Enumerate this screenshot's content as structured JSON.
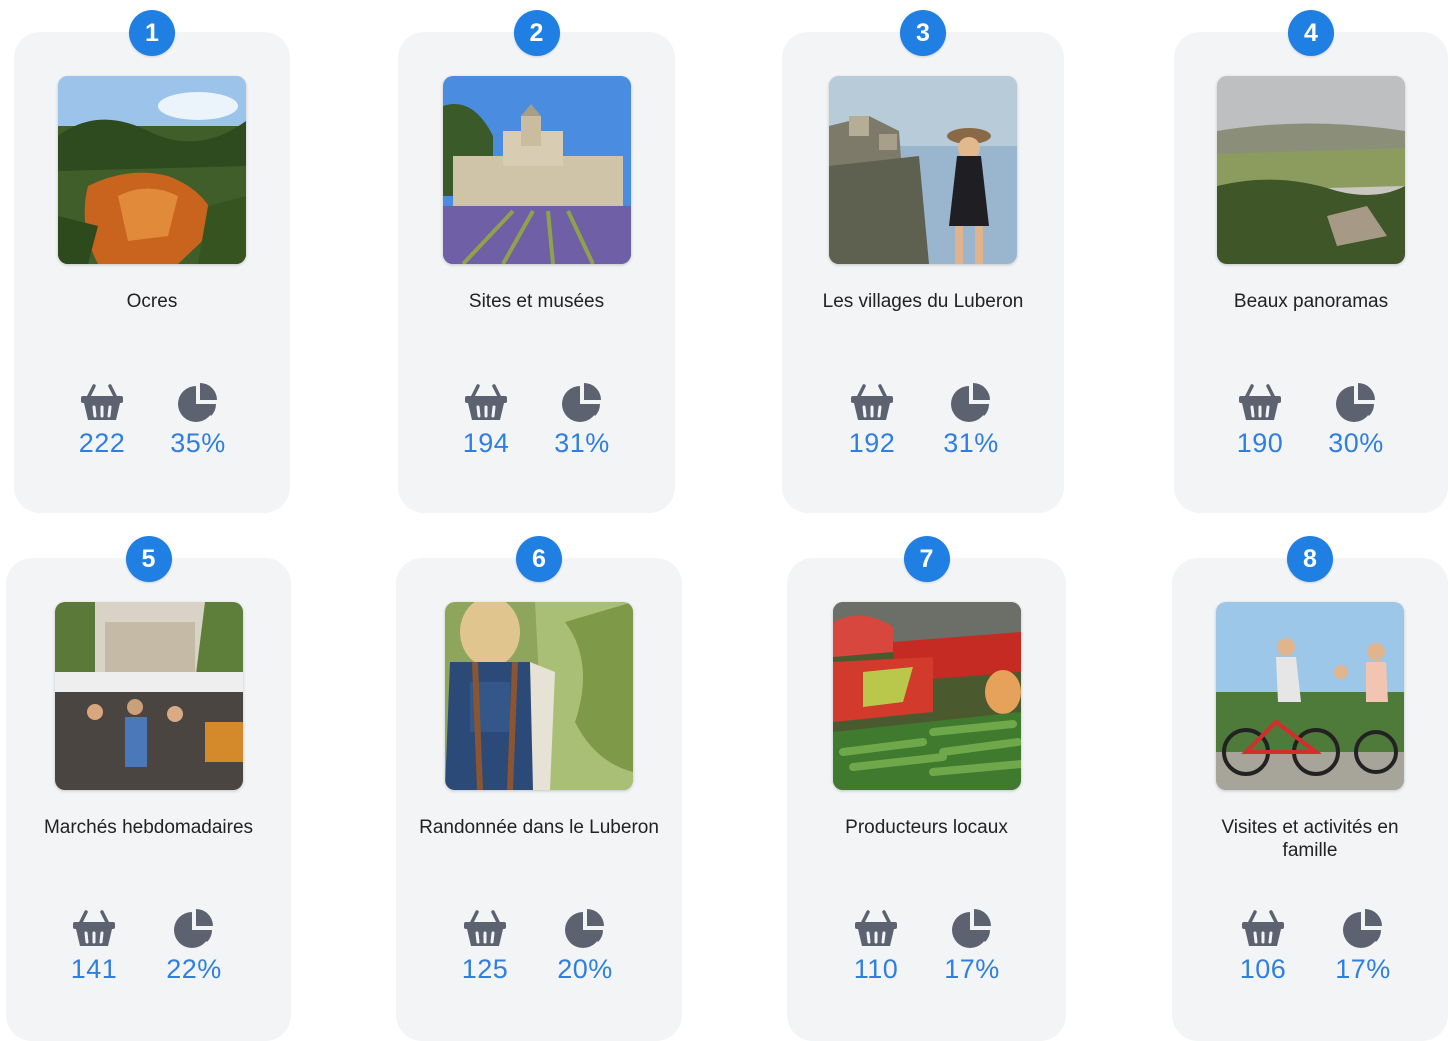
{
  "accent_color": "#1f7fe3",
  "value_color": "#2f7fe0",
  "icon_color": "#5c6270",
  "cards": [
    {
      "rank": "1",
      "title": "Ocres",
      "count": "222",
      "percent": "35%",
      "image": "ochre-cliffs-photo"
    },
    {
      "rank": "2",
      "title": "Sites et musées",
      "count": "194",
      "percent": "31%",
      "image": "abbey-lavender-photo"
    },
    {
      "rank": "3",
      "title": "Les villages du Luberon",
      "count": "192",
      "percent": "31%",
      "image": "village-woman-photo"
    },
    {
      "rank": "4",
      "title": "Beaux panoramas",
      "count": "190",
      "percent": "30%",
      "image": "valley-panorama-photo"
    },
    {
      "rank": "5",
      "title": "Marchés hebdomadaires",
      "count": "141",
      "percent": "22%",
      "image": "market-crowd-photo"
    },
    {
      "rank": "6",
      "title": "Randonnée dans le Luberon",
      "count": "125",
      "percent": "20%",
      "image": "hiker-forest-photo"
    },
    {
      "rank": "7",
      "title": "Producteurs locaux",
      "count": "110",
      "percent": "17%",
      "image": "vegetables-stall-photo"
    },
    {
      "rank": "8",
      "title": "Visites et activités en famille",
      "count": "106",
      "percent": "17%",
      "image": "family-cycling-photo"
    }
  ],
  "icons": {
    "count": "basket-icon",
    "percent": "pie-chart-icon"
  }
}
